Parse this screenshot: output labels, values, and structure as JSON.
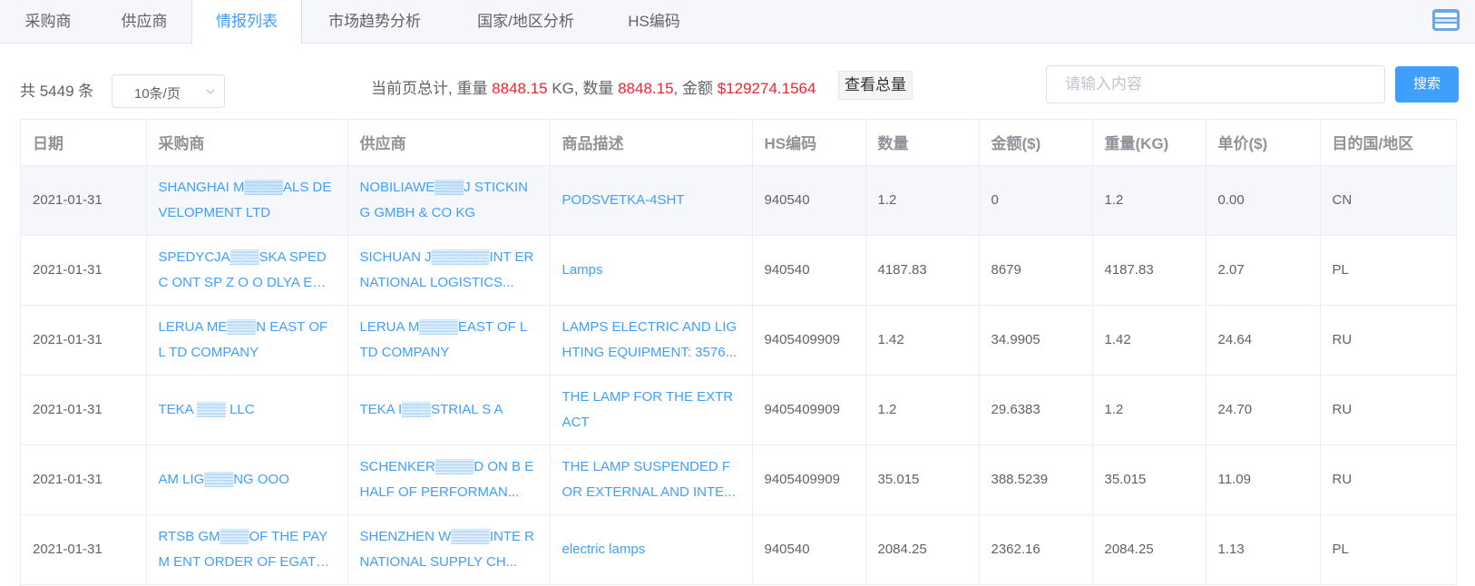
{
  "tabs": [
    {
      "label": "采购商",
      "active": false
    },
    {
      "label": "供应商",
      "active": false
    },
    {
      "label": "情报列表",
      "active": true
    },
    {
      "label": "市场趋势分析",
      "active": false
    },
    {
      "label": "国家/地区分析",
      "active": false
    },
    {
      "label": "HS编码",
      "active": false
    }
  ],
  "toolbar": {
    "count_text": "共 5449 条",
    "page_size": "10条/页",
    "summary_prefix": "当前页总计, 重量 ",
    "weight": "8848.15",
    "unit_kg": " KG, 数量 ",
    "quantity": "8848.15",
    "amount_label": ", 金额 ",
    "amount": "$129274.1564",
    "view_total": "查看总量",
    "search_placeholder": "请输入内容",
    "search_button": "搜索"
  },
  "table": {
    "columns": [
      "日期",
      "采购商",
      "供应商",
      "商品描述",
      "HS编码",
      "数量",
      "金额($)",
      "重量(KG)",
      "单价($)",
      "目的国/地区"
    ],
    "rows": [
      [
        "2021-01-31",
        "SHANGHAI M▒▒▒▒ALS DE VELOPMENT LTD",
        "NOBILIAWE▒▒▒J STICKING GMBH & CO KG",
        "PODSVETKA-4SHT",
        "940540",
        "1.2",
        "0",
        "1.2",
        "0.00",
        "CN"
      ],
      [
        "2021-01-31",
        "SPEDYCJA▒▒▒SKA SPEDC ONT SP Z O O DLYA EGA...",
        "SICHUAN J▒▒▒▒▒▒INT ERNATIONAL LOGISTICS...",
        "Lamps",
        "940540",
        "4187.83",
        "8679",
        "4187.83",
        "2.07",
        "PL"
      ],
      [
        "2021-01-31",
        "LERUA ME▒▒▒N EAST OF L TD COMPANY",
        "LERUA M▒▒▒▒EAST OF L TD COMPANY",
        "LAMPS ELECTRIC AND LIG HTING EQUIPMENT: 3576...",
        "9405409909",
        "1.42",
        "34.9905",
        "1.42",
        "24.64",
        "RU"
      ],
      [
        "2021-01-31",
        "TEKA ▒▒▒ LLC",
        "TEKA I▒▒▒STRIAL S A",
        "THE LAMP FOR THE EXTR ACT",
        "9405409909",
        "1.2",
        "29.6383",
        "1.2",
        "24.70",
        "RU"
      ],
      [
        "2021-01-31",
        "AM LIG▒▒▒NG OOO",
        "SCHENKER▒▒▒▒D ON B EHALF OF PERFORMAN...",
        "THE LAMP SUSPENDED F OR EXTERNAL AND INTE...",
        "9405409909",
        "35.015",
        "388.5239",
        "35.015",
        "11.09",
        "RU"
      ],
      [
        "2021-01-31",
        "RTSB GM▒▒▒OF THE PAYM ENT ORDER OF EGATE ...",
        "SHENZHEN W▒▒▒▒INTE RNATIONAL SUPPLY CH...",
        "electric lamps",
        "940540",
        "2084.25",
        "2362.16",
        "2084.25",
        "1.13",
        "PL"
      ]
    ]
  },
  "colors": {
    "accent": "#409eff",
    "highlight_red": "#f5222d",
    "row_hover": "#f5f7fa"
  },
  "icons": {
    "tab_bar_right": "print-icon",
    "page_size": "chevron-down-icon"
  }
}
